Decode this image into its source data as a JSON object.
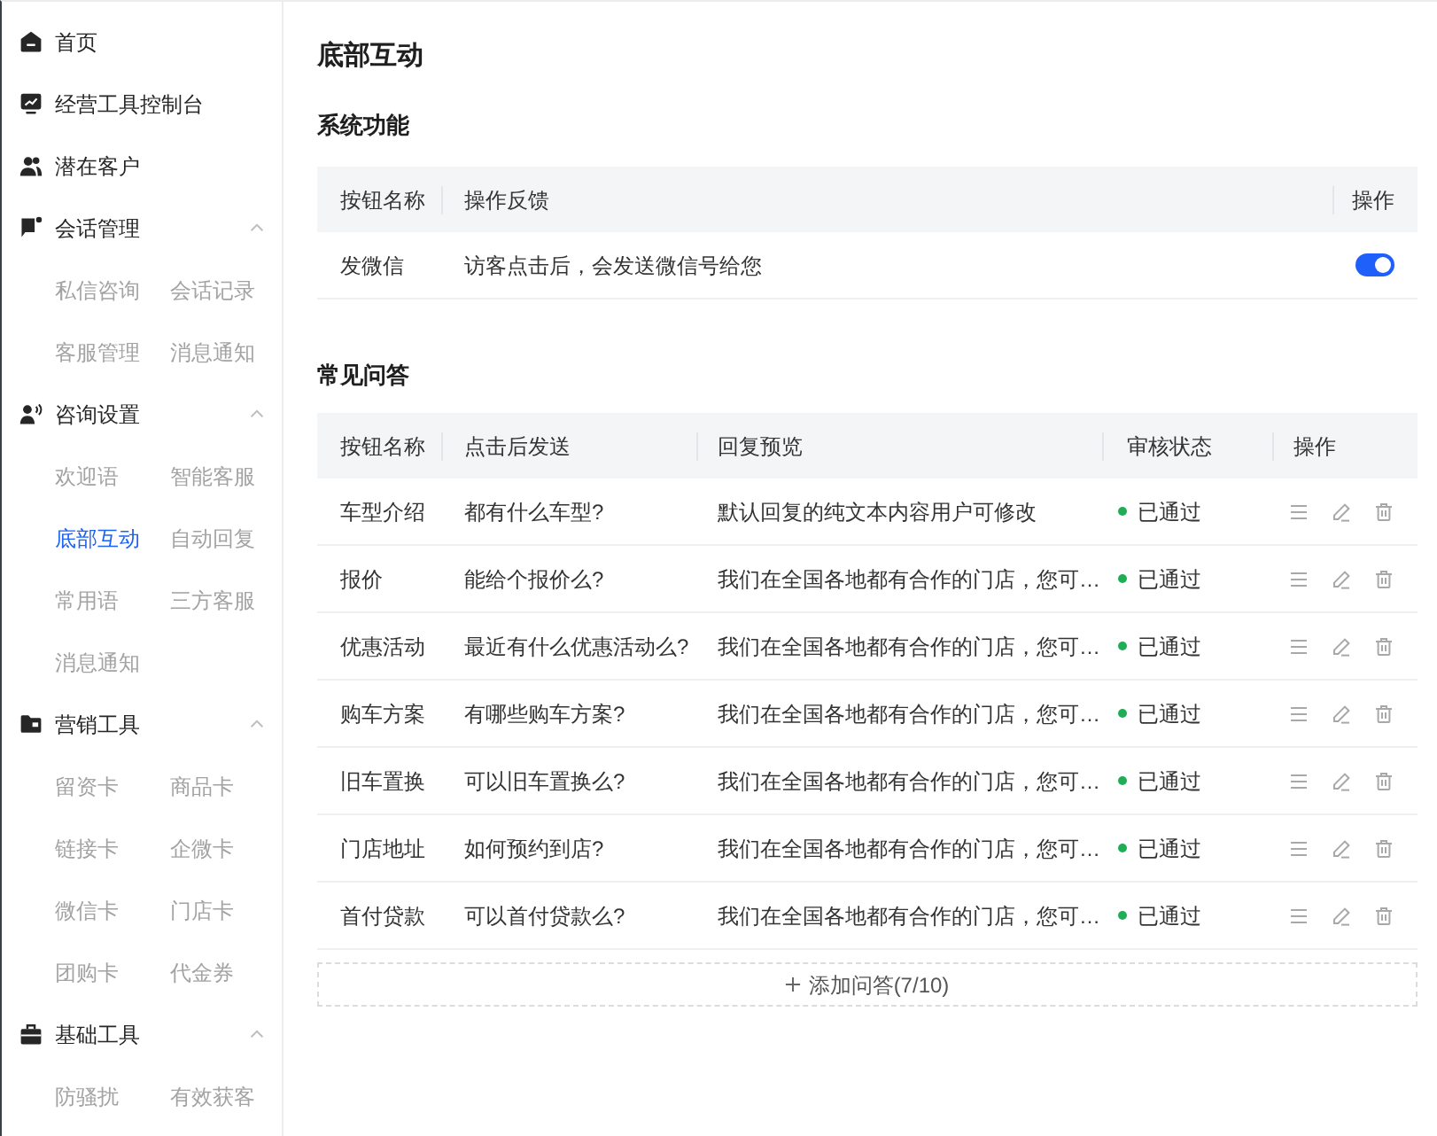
{
  "sidebar": {
    "items": [
      {
        "kind": "link",
        "label": "首页",
        "selected": false
      },
      {
        "kind": "link",
        "label": "经营工具控制台",
        "selected": false
      },
      {
        "kind": "link",
        "label": "潜在客户",
        "selected": false
      },
      {
        "kind": "group",
        "label": "会话管理",
        "expanded": true,
        "children": [
          {
            "label": "私信咨询",
            "selected": false
          },
          {
            "label": "会话记录",
            "selected": false
          },
          {
            "label": "客服管理",
            "selected": false
          },
          {
            "label": "消息通知",
            "selected": false
          }
        ]
      },
      {
        "kind": "group",
        "label": "咨询设置",
        "expanded": true,
        "children": [
          {
            "label": "欢迎语",
            "selected": false
          },
          {
            "label": "智能客服",
            "selected": false
          },
          {
            "label": "底部互动",
            "selected": true
          },
          {
            "label": "自动回复",
            "selected": false
          },
          {
            "label": "常用语",
            "selected": false
          },
          {
            "label": "三方客服",
            "selected": false
          },
          {
            "label": "消息通知",
            "selected": false
          }
        ]
      },
      {
        "kind": "group",
        "label": "营销工具",
        "expanded": true,
        "children": [
          {
            "label": "留资卡",
            "selected": false
          },
          {
            "label": "商品卡",
            "selected": false
          },
          {
            "label": "链接卡",
            "selected": false
          },
          {
            "label": "企微卡",
            "selected": false
          },
          {
            "label": "微信卡",
            "selected": false
          },
          {
            "label": "门店卡",
            "selected": false
          },
          {
            "label": "团购卡",
            "selected": false
          },
          {
            "label": "代金券",
            "selected": false
          }
        ]
      },
      {
        "kind": "group",
        "label": "基础工具",
        "expanded": true,
        "children": [
          {
            "label": "防骚扰",
            "selected": false
          },
          {
            "label": "有效获客",
            "selected": false
          }
        ]
      }
    ]
  },
  "page_title": "底部互动",
  "system_functions": {
    "title": "系统功能",
    "columns": [
      "按钮名称",
      "操作反馈",
      "操作"
    ],
    "rows": [
      {
        "name": "发微信",
        "feedback": "访客点击后，会发送微信号给您",
        "on": true
      }
    ]
  },
  "faq": {
    "title": "常见问答",
    "columns": [
      "按钮名称",
      "点击后发送",
      "回复预览",
      "审核状态",
      "操作"
    ],
    "rows": [
      {
        "name": "车型介绍",
        "send": "都有什么车型?",
        "preview": "默认回复的纯文本内容用户可修改",
        "status": {
          "label": "已通过",
          "color": "#1fae55"
        }
      },
      {
        "name": "报价",
        "send": "能给个报价么?",
        "preview": "我们在全国各地都有合作的门店，您可…",
        "status": {
          "label": "已通过",
          "color": "#1fae55"
        }
      },
      {
        "name": "优惠活动",
        "send": "最近有什么优惠活动么?",
        "preview": "我们在全国各地都有合作的门店，您可…",
        "status": {
          "label": "已通过",
          "color": "#1fae55"
        }
      },
      {
        "name": "购车方案",
        "send": "有哪些购车方案?",
        "preview": "我们在全国各地都有合作的门店，您可…",
        "status": {
          "label": "已通过",
          "color": "#1fae55"
        }
      },
      {
        "name": "旧车置换",
        "send": "可以旧车置换么?",
        "preview": "我们在全国各地都有合作的门店，您可…",
        "status": {
          "label": "已通过",
          "color": "#1fae55"
        }
      },
      {
        "name": "门店地址",
        "send": "如何预约到店?",
        "preview": "我们在全国各地都有合作的门店，您可…",
        "status": {
          "label": "已通过",
          "color": "#1fae55"
        }
      },
      {
        "name": "首付贷款",
        "send": "可以首付贷款么?",
        "preview": "我们在全国各地都有合作的门店，您可…",
        "status": {
          "label": "已通过",
          "color": "#1fae55"
        }
      }
    ],
    "add_button": "添加问答(7/10)"
  }
}
